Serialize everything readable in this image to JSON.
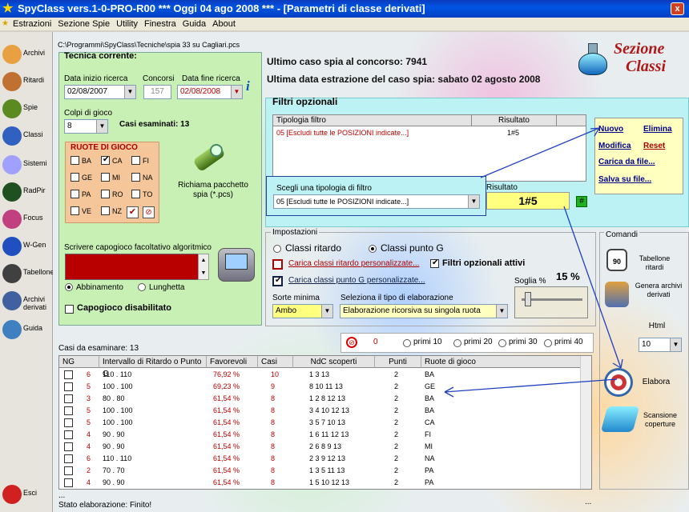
{
  "window": {
    "title": "SpyClass vers.1-0-PRO-R00  ***  Oggi 04 ago 2008  ***  - [Parametri di classe derivati]",
    "close": "x"
  },
  "menu": [
    "Estrazioni",
    "Sezione Spie",
    "Utility",
    "Finestra",
    "Guida",
    "About"
  ],
  "sidebar": [
    {
      "label": "Archivi",
      "icon": "pencil-icon",
      "color": "#e8a040"
    },
    {
      "label": "Ritardi",
      "icon": "clock-icon",
      "color": "#c07030"
    },
    {
      "label": "Spie",
      "icon": "spyglass-icon",
      "color": "#5a8a20"
    },
    {
      "label": "Classi",
      "icon": "flask-icon",
      "color": "#3060c0"
    },
    {
      "label": "Sistemi",
      "icon": "bulb-icon",
      "color": "#a0a0ff"
    },
    {
      "label": "RadPir",
      "icon": "pyramid-icon",
      "color": "#205020"
    },
    {
      "label": "Focus",
      "icon": "balls-icon",
      "color": "#c04080"
    },
    {
      "label": "W-Gen",
      "icon": "globe-icon",
      "color": "#2050c0"
    },
    {
      "label": "Tabellone",
      "icon": "calendar-icon",
      "color": "#404040"
    },
    {
      "label": "Archivi derivati",
      "icon": "tools-icon",
      "color": "#4060a0"
    },
    {
      "label": "Guida",
      "icon": "book-icon",
      "color": "#4080c0"
    },
    {
      "label": "Esci",
      "icon": "exit-icon",
      "color": "#d02020"
    }
  ],
  "path": "C:\\Programmi\\SpyClass\\Tecniche\\spia 33 su Cagliari.pcs",
  "tecnica": {
    "title": "Tecnica corrente:",
    "data_inizio_label": "Data inizio ricerca",
    "data_inizio": "02/08/2007",
    "concorsi_label": "Concorsi",
    "concorsi": "157",
    "data_fine_label": "Data fine ricerca",
    "data_fine": "02/08/2008",
    "colpi_label": "Colpi di gioco",
    "colpi": "8",
    "casi_esaminati": "Casi esaminati: 13",
    "ruote_title": "RUOTE DI GIOCO",
    "ruote": [
      [
        "BA",
        "CA",
        "FI"
      ],
      [
        "GE",
        "MI",
        "NA"
      ],
      [
        "PA",
        "RO",
        "TO"
      ],
      [
        "VE",
        "NZ",
        ""
      ]
    ],
    "richiama": "Richiama pacchetto spia (*.pcs)",
    "capogioco_label": "Scrivere capogioco facoltativo algoritmico",
    "abbinamento": "Abbinamento",
    "lunghetta": "Lunghetta",
    "capogioco_disab": "Capogioco disabilitato"
  },
  "header": {
    "ultimo": "Ultimo caso spia al concorso: 7941",
    "ultima_data": "Ultima data estrazione del caso spia: sabato 02 agosto 2008",
    "sezione1": "Sezione",
    "sezione2": "Classi"
  },
  "filtri": {
    "title": "Filtri opzionali",
    "col1": "Tipologia filtro",
    "col2": "Risultato",
    "row_tipo": "05 [Escludi tutte le POSIZIONI indicate...]",
    "row_res": "1#5",
    "scegli_label": "Scegli una tipologia di filtro",
    "scegli_value": "05 [Escludi tutte le POSIZIONI indicate...]",
    "risultato_label": "Risultato",
    "risultato_value": "1#5",
    "hash": "#",
    "links": {
      "nuovo": "Nuovo",
      "elimina": "Elimina",
      "modifica": "Modifica",
      "reset": "Reset",
      "carica": "Carica da file...",
      "salva": "Salva su file..."
    }
  },
  "impostazioni": {
    "title": "Impostazioni",
    "classi_ritardo": "Classi ritardo",
    "classi_puntoG": "Classi punto G",
    "carica_rit": "Carica classi ritardo personalizzate...",
    "filtri_attivi": "Filtri opzionali attivi",
    "carica_g": "Carica classi punto G personalizzate...",
    "soglia_label": "Soglia %",
    "soglia": "15 %",
    "sorte_label": "Sorte minima",
    "sorte": "Ambo",
    "tipo_label": "Seleziona il tipo di elaborazione",
    "tipo": "Elaborazione ricorsiva su singola ruota"
  },
  "primi": {
    "zero": "0",
    "p10": "primi 10",
    "p20": "primi 20",
    "p30": "primi 30",
    "p40": "primi 40"
  },
  "comandi": {
    "title": "Comandi",
    "tabellone": "Tabellone ritardi",
    "genera": "Genera archivi derivati",
    "html": "Html",
    "html_val": "10",
    "elabora": "Elabora",
    "scansione": "Scansione coperture"
  },
  "casi": {
    "label": "Casi da esaminare: 13",
    "headers": [
      "NG",
      "Intervallo di Ritardo o Punto G",
      "Favorevoli",
      "Casi",
      "NdC scoperti",
      "Punti",
      "Ruote di gioco"
    ],
    "rows": [
      [
        "6",
        "110 . 110",
        "76,92 %",
        "10",
        "1 3 13",
        "2",
        "BA"
      ],
      [
        "5",
        "100 . 100",
        "69,23 %",
        "9",
        "8 10 11 13",
        "2",
        "GE"
      ],
      [
        "3",
        "80 . 80",
        "61,54 %",
        "8",
        "1 2 8 12 13",
        "2",
        "BA"
      ],
      [
        "5",
        "100 . 100",
        "61,54 %",
        "8",
        "3 4 10 12 13",
        "2",
        "BA"
      ],
      [
        "5",
        "100 . 100",
        "61,54 %",
        "8",
        "3 5 7 10 13",
        "2",
        "CA"
      ],
      [
        "4",
        "90 . 90",
        "61,54 %",
        "8",
        "1 6 11 12 13",
        "2",
        "FI"
      ],
      [
        "4",
        "90 . 90",
        "61,54 %",
        "8",
        "2 6 8 9 13",
        "2",
        "MI"
      ],
      [
        "6",
        "110 . 110",
        "61,54 %",
        "8",
        "2 3 9 12 13",
        "2",
        "NA"
      ],
      [
        "2",
        "70 . 70",
        "61,54 %",
        "8",
        "1 3 5 11 13",
        "2",
        "PA"
      ],
      [
        "4",
        "90 . 90",
        "61,54 %",
        "8",
        "1 5 10 12 13",
        "2",
        "PA"
      ]
    ]
  },
  "status": {
    "dots": "...",
    "text": "Stato elaborazione: Finito!",
    "dots2": "..."
  }
}
